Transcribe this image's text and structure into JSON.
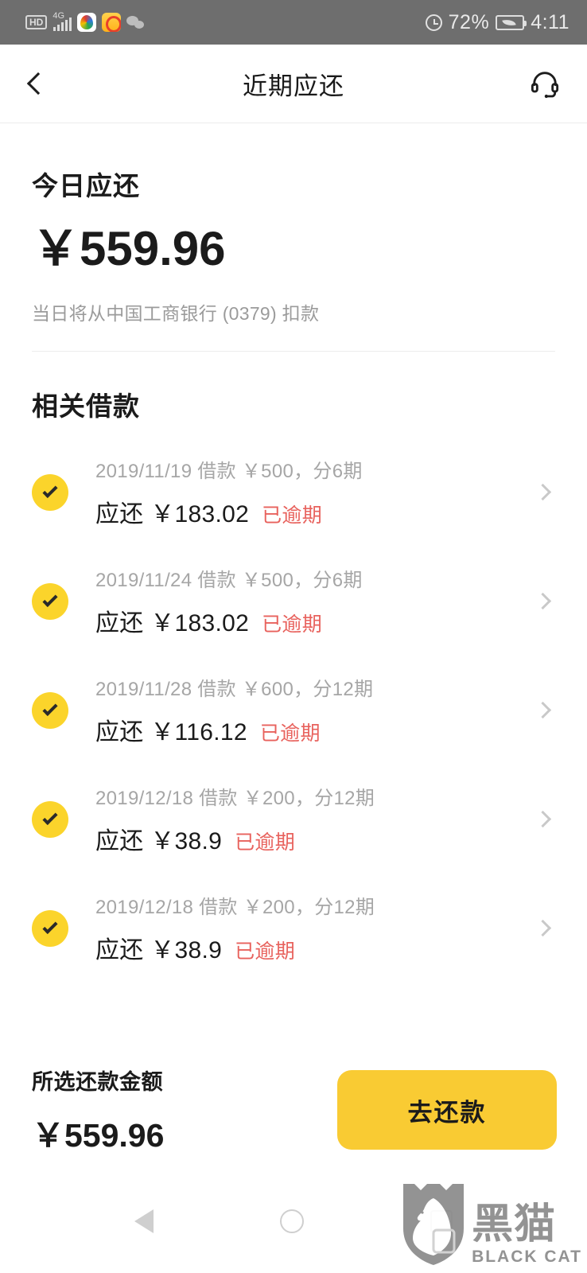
{
  "status_bar": {
    "hd_label": "HD",
    "network_label": "4G",
    "battery_percent": "72%",
    "time": "4:11",
    "icons": [
      "hd-icon",
      "signal-icon",
      "uc-browser-icon",
      "weibo-icon",
      "wechat-icon",
      "alarm-icon",
      "battery-icon"
    ]
  },
  "header": {
    "title": "近期应还",
    "back_icon": "chevron-left-icon",
    "service_icon": "headset-icon"
  },
  "today": {
    "label": "今日应还",
    "amount": "￥559.96",
    "note": "当日将从中国工商银行 (0379) 扣款"
  },
  "loans_section": {
    "title": "相关借款",
    "rows": [
      {
        "meta": "2019/11/19 借款 ￥500，分6期",
        "due": "应还 ￥183.02",
        "status": "已逾期",
        "checked": true
      },
      {
        "meta": "2019/11/24 借款 ￥500，分6期",
        "due": "应还 ￥183.02",
        "status": "已逾期",
        "checked": true
      },
      {
        "meta": "2019/11/28 借款 ￥600，分12期",
        "due": "应还 ￥116.12",
        "status": "已逾期",
        "checked": true
      },
      {
        "meta": "2019/12/18 借款 ￥200，分12期",
        "due": "应还 ￥38.9",
        "status": "已逾期",
        "checked": true
      },
      {
        "meta": "2019/12/18 借款 ￥200，分12期",
        "due": "应还 ￥38.9",
        "status": "已逾期",
        "checked": true
      }
    ]
  },
  "bottom_bar": {
    "selected_label": "所选还款金额",
    "selected_amount": "￥559.96",
    "pay_button": "去还款"
  },
  "android_nav": {
    "back_icon": "nav-back-icon",
    "home_icon": "nav-home-icon",
    "recent_icon": "nav-recents-icon"
  },
  "watermark": {
    "cn": "黑猫",
    "en": "BLACK CAT"
  },
  "colors": {
    "accent_yellow": "#fbd42b",
    "button_yellow": "#f9cb33",
    "overdue_red": "#e8625d",
    "statusbar_gray": "#6e6e6e",
    "muted_text": "#a6a6a6"
  }
}
